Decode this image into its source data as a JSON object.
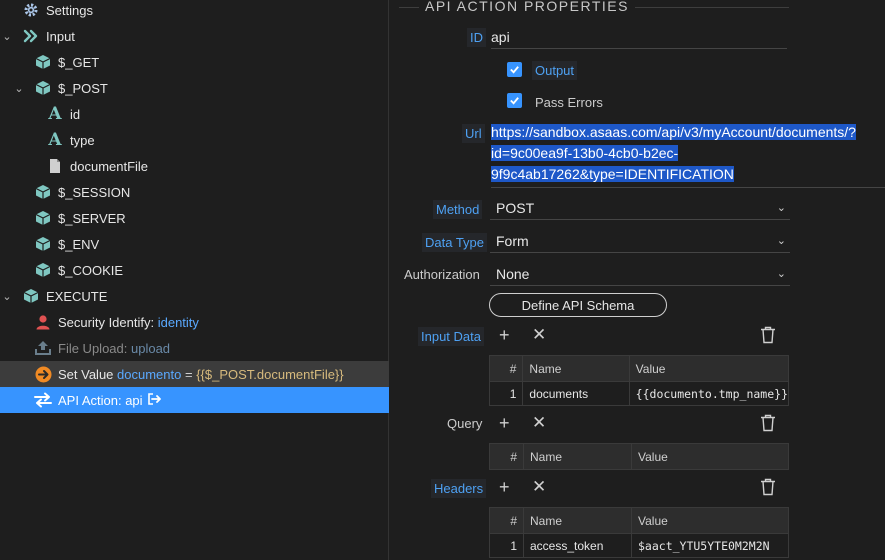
{
  "tree": {
    "settings": "Settings",
    "input": "Input",
    "get": "$_GET",
    "post": "$_POST",
    "post_children": [
      "id",
      "type",
      "documentFile"
    ],
    "session": "$_SESSION",
    "server": "$_SERVER",
    "env": "$_ENV",
    "cookie": "$_COOKIE",
    "execute": "EXECUTE",
    "security_label": "Security Identify: ",
    "security_value": "identity",
    "upload_label": "File Upload: ",
    "upload_value": "upload",
    "setvalue_label": "Set Value ",
    "setvalue_var": "documento",
    "setvalue_eq": " = ",
    "setvalue_expr": "{{$_POST.documentFile}}",
    "api_action": "API Action: api"
  },
  "props": {
    "section_title": "API ACTION PROPERTIES",
    "id_label": "ID",
    "id_value": "api",
    "output_label": "Output",
    "pass_errors_label": "Pass Errors",
    "url_label": "Url",
    "url_lines": [
      "https://sandbox.asaas.com/api/v3/myAccount/documents/?",
      "id=9c00ea9f-13b0-4cb0-b2ec-",
      "9f9c4ab17262&type=IDENTIFICATION"
    ],
    "method_label": "Method",
    "method_value": "POST",
    "datatype_label": "Data Type",
    "datatype_value": "Form",
    "auth_label": "Authorization",
    "auth_value": "None",
    "define_schema": "Define API Schema",
    "input_data_label": "Input Data",
    "query_label": "Query",
    "headers_label": "Headers",
    "col_num": "#",
    "col_name": "Name",
    "col_value": "Value",
    "input_rows": [
      {
        "num": "1",
        "name": "documents",
        "value": "{{documento.tmp_name}}"
      }
    ],
    "header_rows": [
      {
        "num": "1",
        "name": "access_token",
        "value": "$aact_YTU5YTE0M2M2N"
      }
    ]
  },
  "colors": {
    "accent": "#3794ff",
    "teal_icon": "#7fc7c1",
    "person_icon": "#e05252",
    "orange_icon": "#f08a24"
  }
}
